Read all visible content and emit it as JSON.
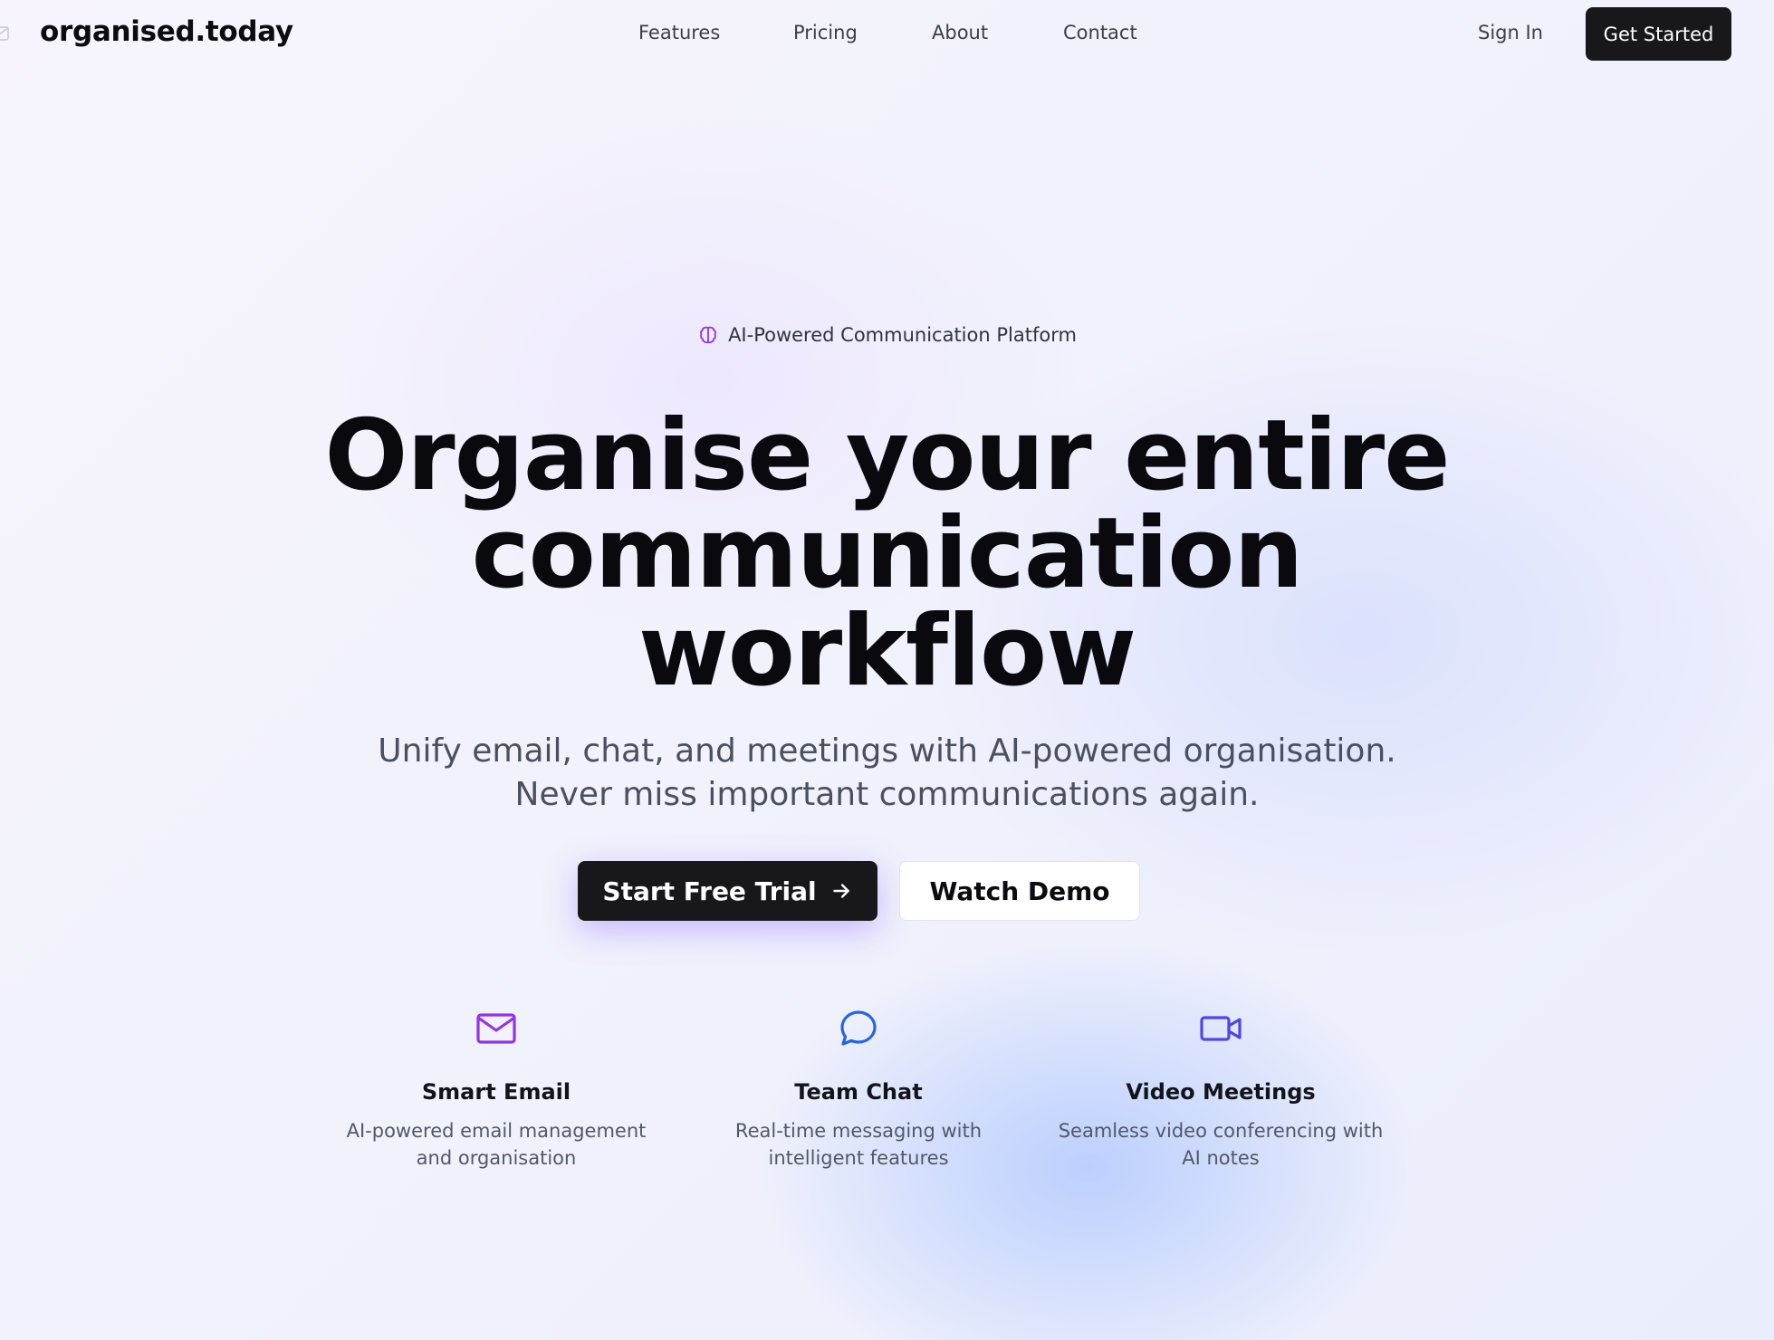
{
  "header": {
    "logo_text": "organised.today",
    "nav": [
      "Features",
      "Pricing",
      "About",
      "Contact"
    ],
    "sign_in": "Sign In",
    "get_started": "Get Started"
  },
  "hero": {
    "badge": "AI-Powered Communication Platform",
    "headline_lines": [
      "Organise your entire",
      "communication",
      "workflow"
    ],
    "subhead_lines": [
      "Unify email, chat, and meetings with AI-powered organisation.",
      "Never miss important communications again."
    ],
    "primary_cta": "Start Free Trial",
    "secondary_cta": "Watch Demo"
  },
  "features": [
    {
      "icon": "mail-icon",
      "title": "Smart Email",
      "desc_lines": [
        "AI-powered email management",
        "and organisation"
      ],
      "color": "#9333ea"
    },
    {
      "icon": "chat-bubble-icon",
      "title": "Team Chat",
      "desc_lines": [
        "Real-time messaging with",
        "intelligent features"
      ],
      "color": "#2563eb"
    },
    {
      "icon": "video-camera-icon",
      "title": "Video Meetings",
      "desc_lines": [
        "Seamless video conferencing with",
        "AI notes"
      ],
      "color": "#4f46e5"
    }
  ],
  "colors": {
    "primary_button": "#18181b",
    "badge_icon": "#9333ea"
  }
}
